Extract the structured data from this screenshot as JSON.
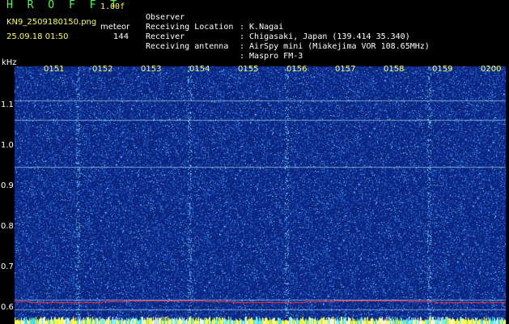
{
  "app": {
    "title": "H R O F F T",
    "version": "1.00f",
    "file_name": "KN9_2509180150.png",
    "mode": "meteor",
    "timestamp": "25.09.18 01:50",
    "count": "144"
  },
  "metadata": [
    {
      "key": "Observer",
      "value": ": K.Nagai"
    },
    {
      "key": "Receiving Location",
      "value": ": Chigasaki, Japan (139.414 35.340)"
    },
    {
      "key": "Receiver",
      "value": ": AirSpy mini (Miakejima VOR 108.65MHz)"
    },
    {
      "key": "Receiving antenna",
      "value": ": Maspro FM-3"
    }
  ],
  "axis": {
    "unit": "kHz",
    "y_ticks": [
      "1.1",
      "1.0",
      "0.9",
      "0.8",
      "0.7",
      "0.6"
    ],
    "x_ticks": [
      "0151",
      "0152",
      "0153",
      "0154",
      "0155",
      "0156",
      "0157",
      "0158",
      "0159",
      "0200"
    ]
  },
  "colors": {
    "background": "#0c2a8a",
    "noise_dark": "#0a1f74",
    "noise_light": "#2e74e0",
    "noise_cyan": "#7fe0ff",
    "carrier": "#ff3040",
    "tick_yellow": "#ffff40"
  }
}
